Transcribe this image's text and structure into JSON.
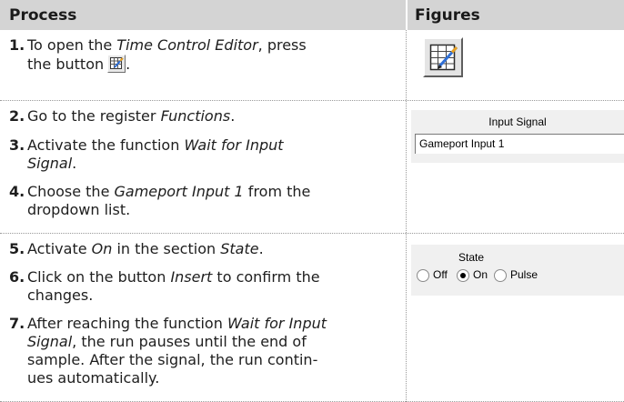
{
  "table": {
    "headers": {
      "process": "Process",
      "figures": "Figures"
    },
    "steps": [
      {
        "number": "1.",
        "parts": [
          "To open the ",
          "Time Control Editor",
          ", press",
          "the button",
          "."
        ],
        "icon": "time-control-editor-icon"
      },
      {
        "number": "2.",
        "parts": [
          "Go to the register ",
          "Functions",
          "."
        ]
      },
      {
        "number": "3.",
        "parts": [
          "Activate the function ",
          "Wait for Input",
          "Signal",
          "."
        ]
      },
      {
        "number": "4.",
        "parts": [
          "Choose the ",
          "Gameport Input 1",
          " from the",
          "dropdown list."
        ]
      },
      {
        "number": "5.",
        "parts": [
          "Activate ",
          "On",
          " in the section ",
          "State",
          "."
        ]
      },
      {
        "number": "6.",
        "parts": [
          "Click on the button ",
          "Insert",
          " to confirm the",
          "changes."
        ]
      },
      {
        "number": "7.",
        "parts": [
          "After reaching the function ",
          "Wait for Input",
          "Signal",
          ", the run pauses until the end of",
          "sample. After the signal, the run contin-",
          "ues automatically."
        ]
      }
    ]
  },
  "figures": {
    "toolbar_button": {
      "icon": "time-control-editor-icon"
    },
    "input_signal": {
      "title": "Input Signal",
      "value": "Gameport Input 1"
    },
    "state": {
      "title": "State",
      "options": [
        {
          "label": "Off",
          "selected": false
        },
        {
          "label": "On",
          "selected": true
        },
        {
          "label": "Pulse",
          "selected": false
        }
      ]
    }
  },
  "colors": {
    "header_bg": "#d4d4d4",
    "separator": "#9a9a9a",
    "text": "#1e1e1e"
  }
}
